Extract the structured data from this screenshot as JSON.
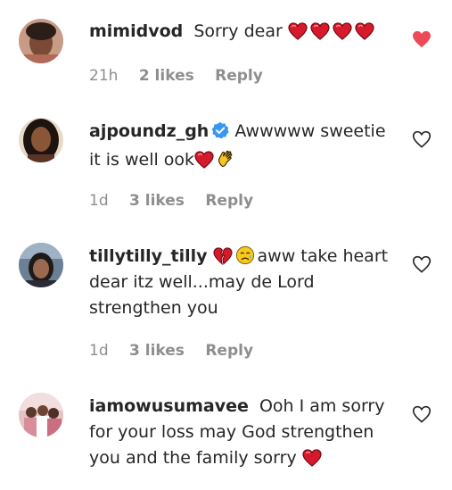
{
  "comments": [
    {
      "username": "mimidvod",
      "text": "Sorry dear",
      "emojis_after": [
        "heart-icon",
        "heart-icon",
        "heart-icon",
        "heart-icon"
      ],
      "time": "21h",
      "likes": "2 likes",
      "reply": "Reply",
      "liked": true
    },
    {
      "username": "ajpoundz_gh",
      "verified": true,
      "text": "Awwwww sweetie it is well ook",
      "emojis_after": [
        "heart-icon",
        "clapping-hands-icon"
      ],
      "time": "1d",
      "likes": "3 likes",
      "reply": "Reply",
      "liked": false
    },
    {
      "username": "tillytilly_tilly",
      "emojis_before": [
        "broken-heart-icon",
        "sad-relieved-face-icon"
      ],
      "text": "aww take heart dear itz well...may de Lord strengthen you",
      "time": "1d",
      "likes": "3 likes",
      "reply": "Reply",
      "liked": false
    },
    {
      "username": "iamowusumavee",
      "text": "Ooh I am sorry for your loss may God strengthen you and the family sorry",
      "emojis_after": [
        "heart-icon"
      ],
      "liked": false
    }
  ],
  "colors": {
    "liked_heart": "#ed4956",
    "meta_text": "#8e8e8e",
    "verified_badge": "#3897f0"
  }
}
